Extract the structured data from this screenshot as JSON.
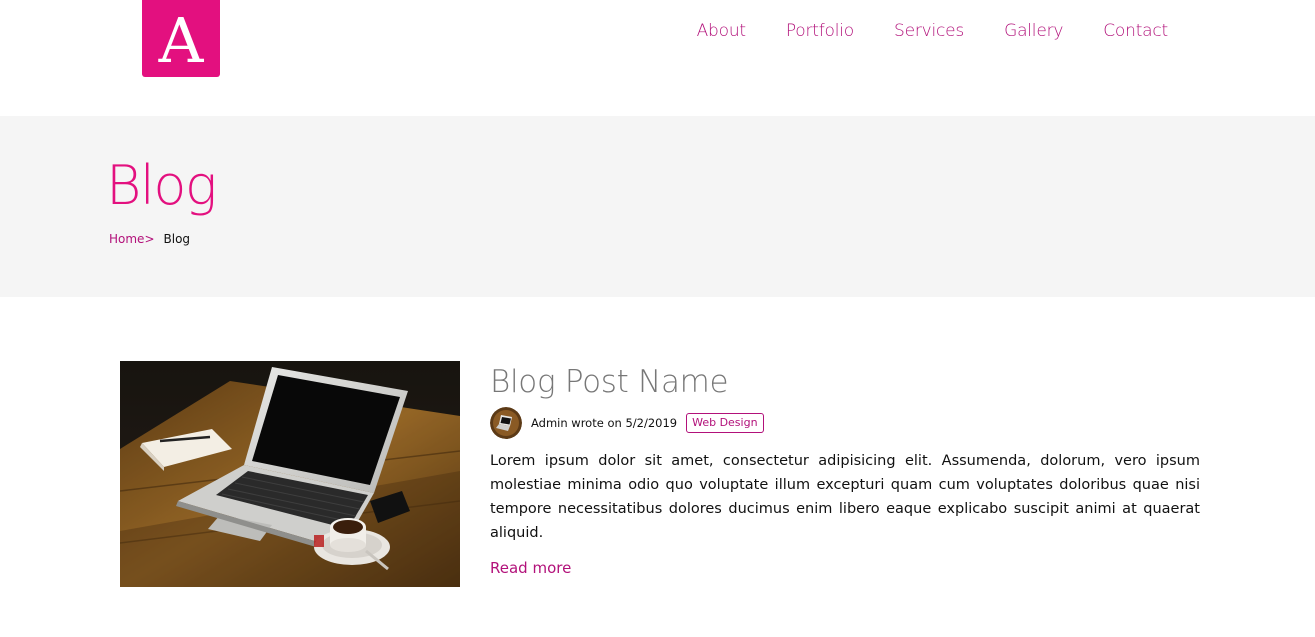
{
  "header": {
    "logo_letter": "A",
    "nav": [
      "About",
      "Portfolio",
      "Services",
      "Gallery",
      "Contact"
    ]
  },
  "banner": {
    "title": "Blog",
    "breadcrumb": {
      "home": "Home",
      "separator": ">",
      "current": "Blog"
    }
  },
  "post": {
    "title": "Blog Post Name",
    "meta": "Admin wrote on 5/2/2019",
    "tag": "Web Design",
    "excerpt": "Lorem ipsum dolor sit amet, consectetur adipisicing elit. Assumenda, dolorum, vero ipsum molestiae minima odio quo voluptate illum excepturi quam cum voluptates doloribus quae nisi tempore necessitatibus dolores ducimus enim libero eaque explicabo suscipit animi at quaerat aliquid.",
    "read_more": "Read more"
  },
  "colors": {
    "accent": "#e3107f",
    "link": "#b2117a",
    "banner_bg": "#f5f5f5"
  }
}
